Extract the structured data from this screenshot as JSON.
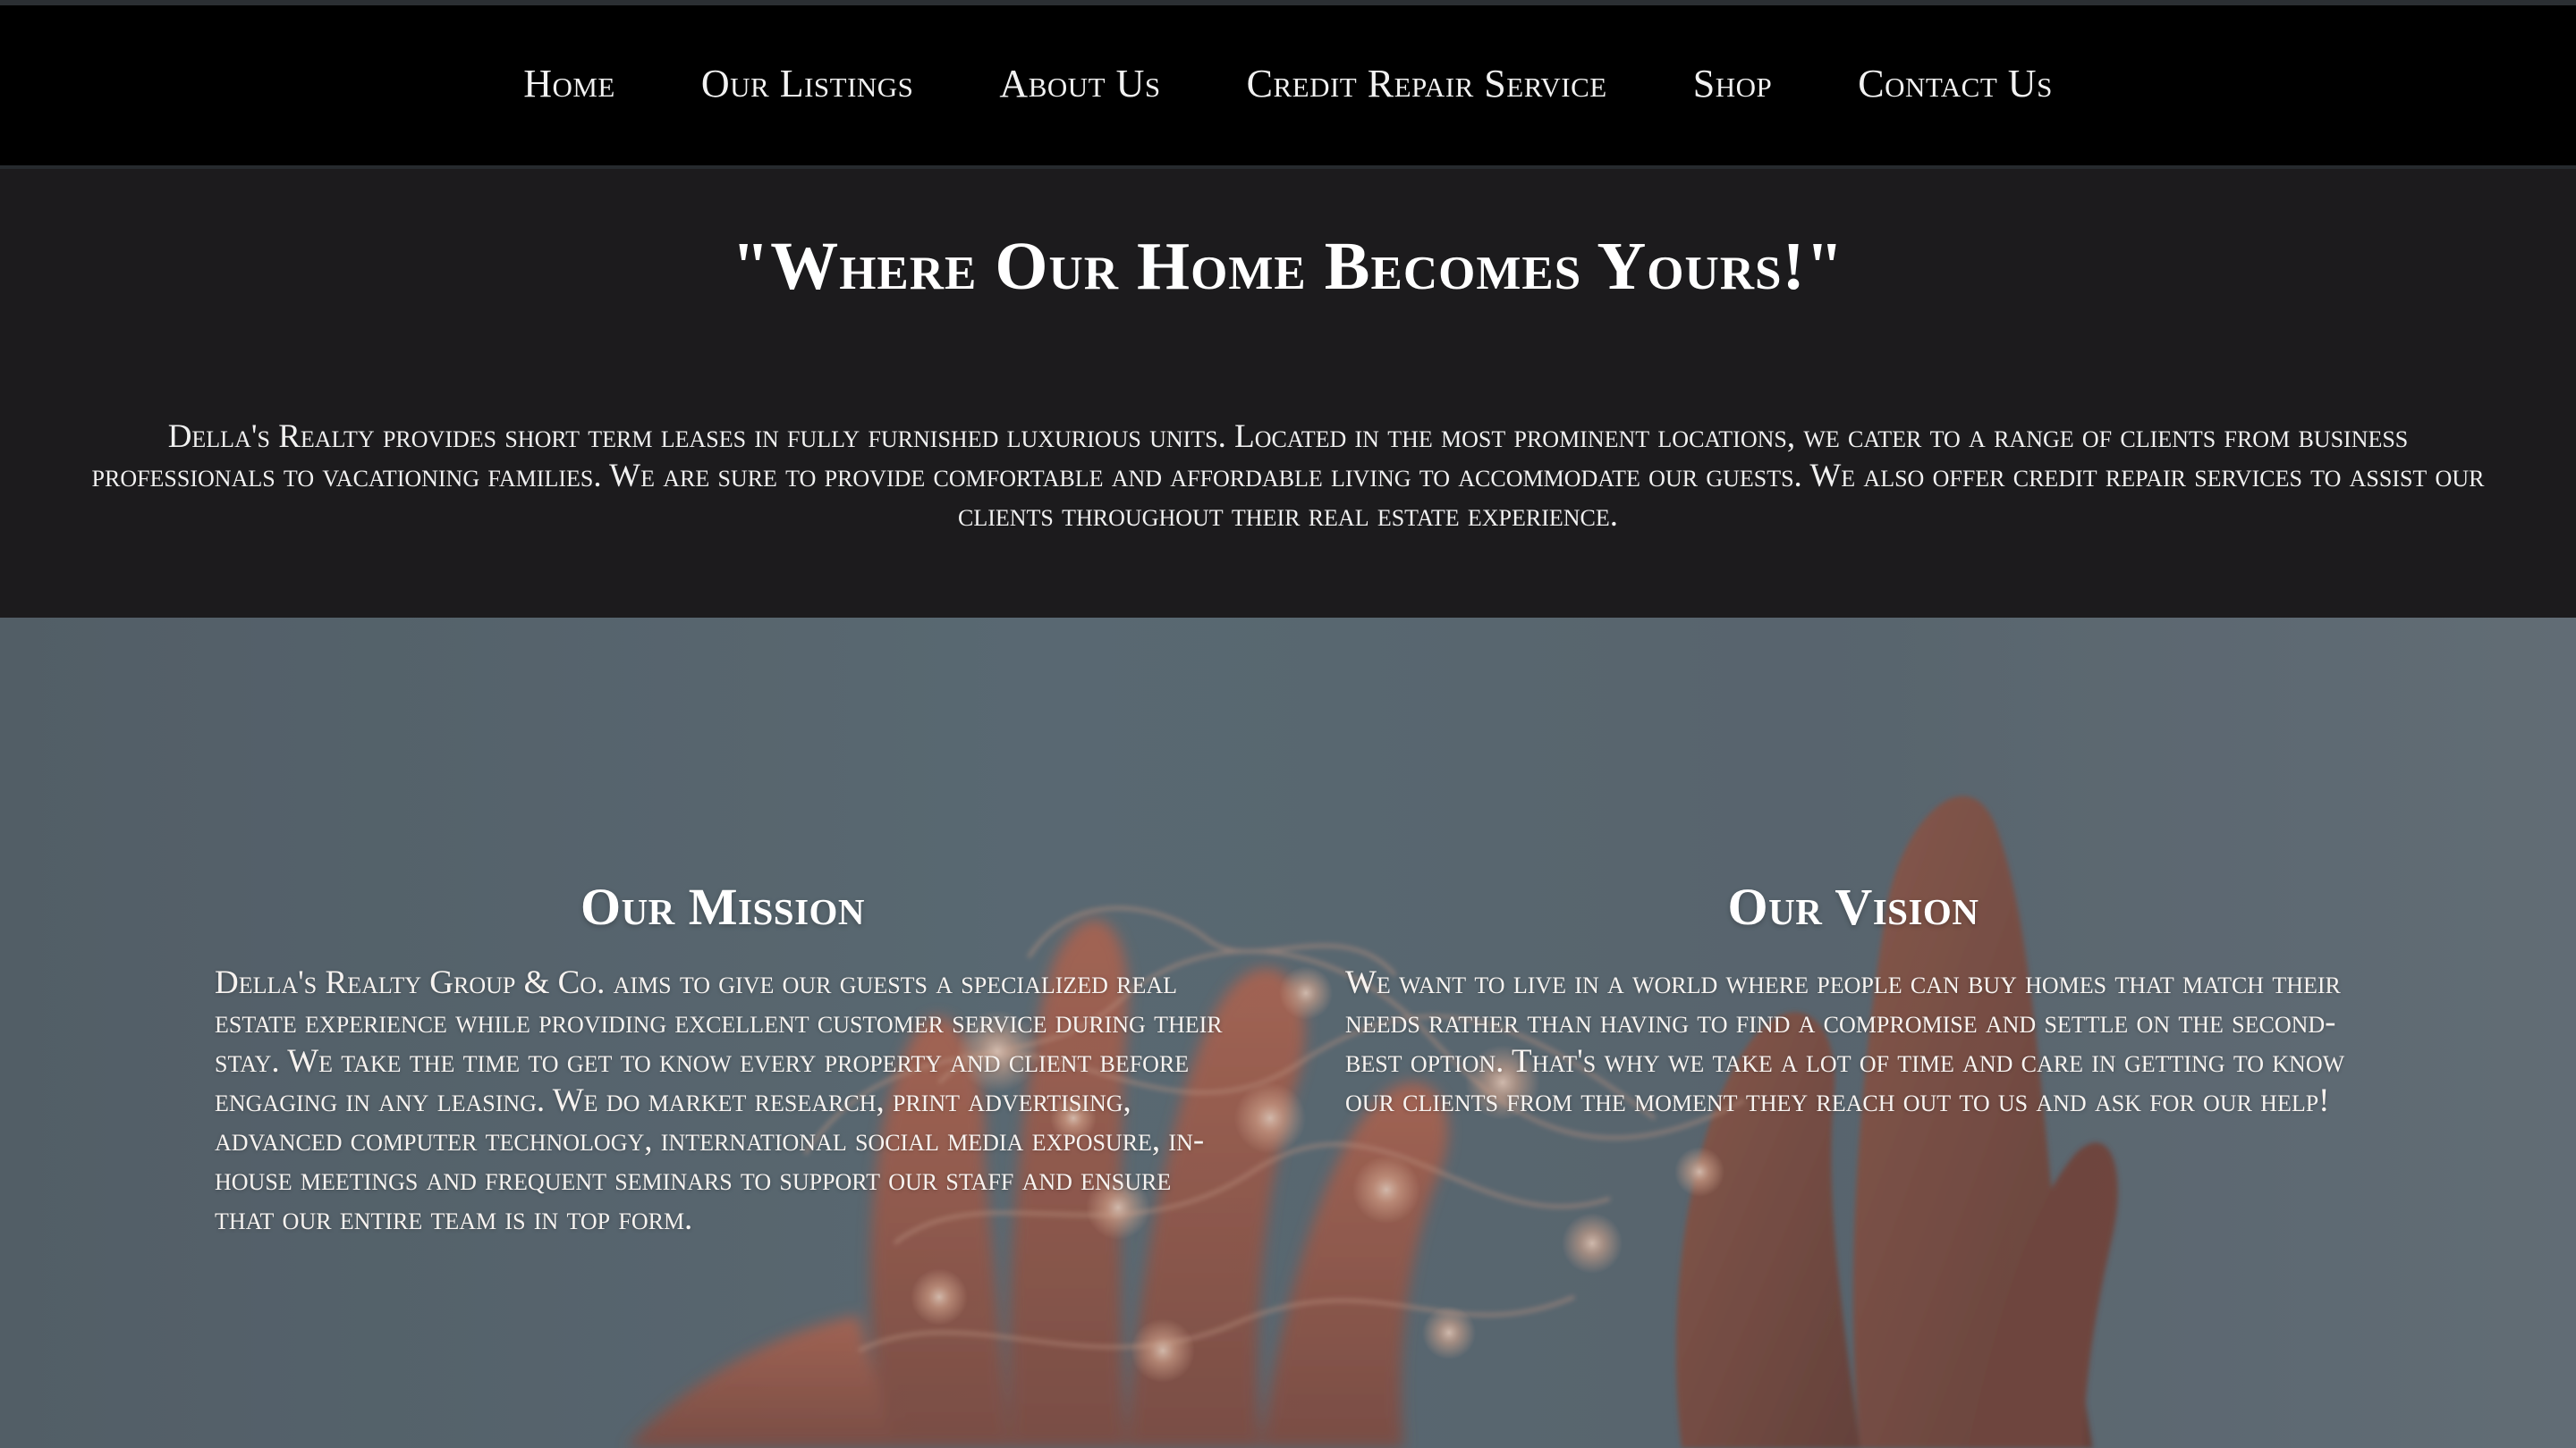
{
  "nav": {
    "items": [
      {
        "label": "Home"
      },
      {
        "label": "Our Listings"
      },
      {
        "label": "About Us"
      },
      {
        "label": "Credit Repair Service"
      },
      {
        "label": "Shop"
      },
      {
        "label": "Contact Us"
      }
    ]
  },
  "intro": {
    "title": "\"Where Our Home Becomes Yours!\"",
    "text": "Della's Realty provides short term leases in fully furnished luxurious units. Located in the most prominent locations, we cater to a range of clients from business professionals to vacationing families. We are sure to provide comfortable and affordable living to accommodate our guests. We also offer credit repair services to assist our clients throughout their real estate experience."
  },
  "mission": {
    "heading": "Our Mission",
    "text": "Della's Realty Group & Co. aims to give our guests a specialized real estate experience while providing excellent customer service during their stay. We take the time to get to know every property and client before engaging in any leasing. We do market research, print advertising, advanced computer technology, international social media exposure, in-house meetings and frequent seminars to support our staff and ensure that our entire team is in top form."
  },
  "vision": {
    "heading": "Our Vision",
    "text": "We want to live in a world where people can buy homes that match their needs rather than having to find a compromise and settle on the second-best option. That's why we take a lot of time and care in getting to know our clients from the moment they reach out to us and ask for our help!"
  },
  "colors": {
    "navbar": "#000000",
    "intro_background": "#1c1b1d",
    "hero_background": "#5e6b74",
    "text": "#ffffff"
  },
  "images": {
    "hero": "hands holding glowing fairy lights"
  }
}
